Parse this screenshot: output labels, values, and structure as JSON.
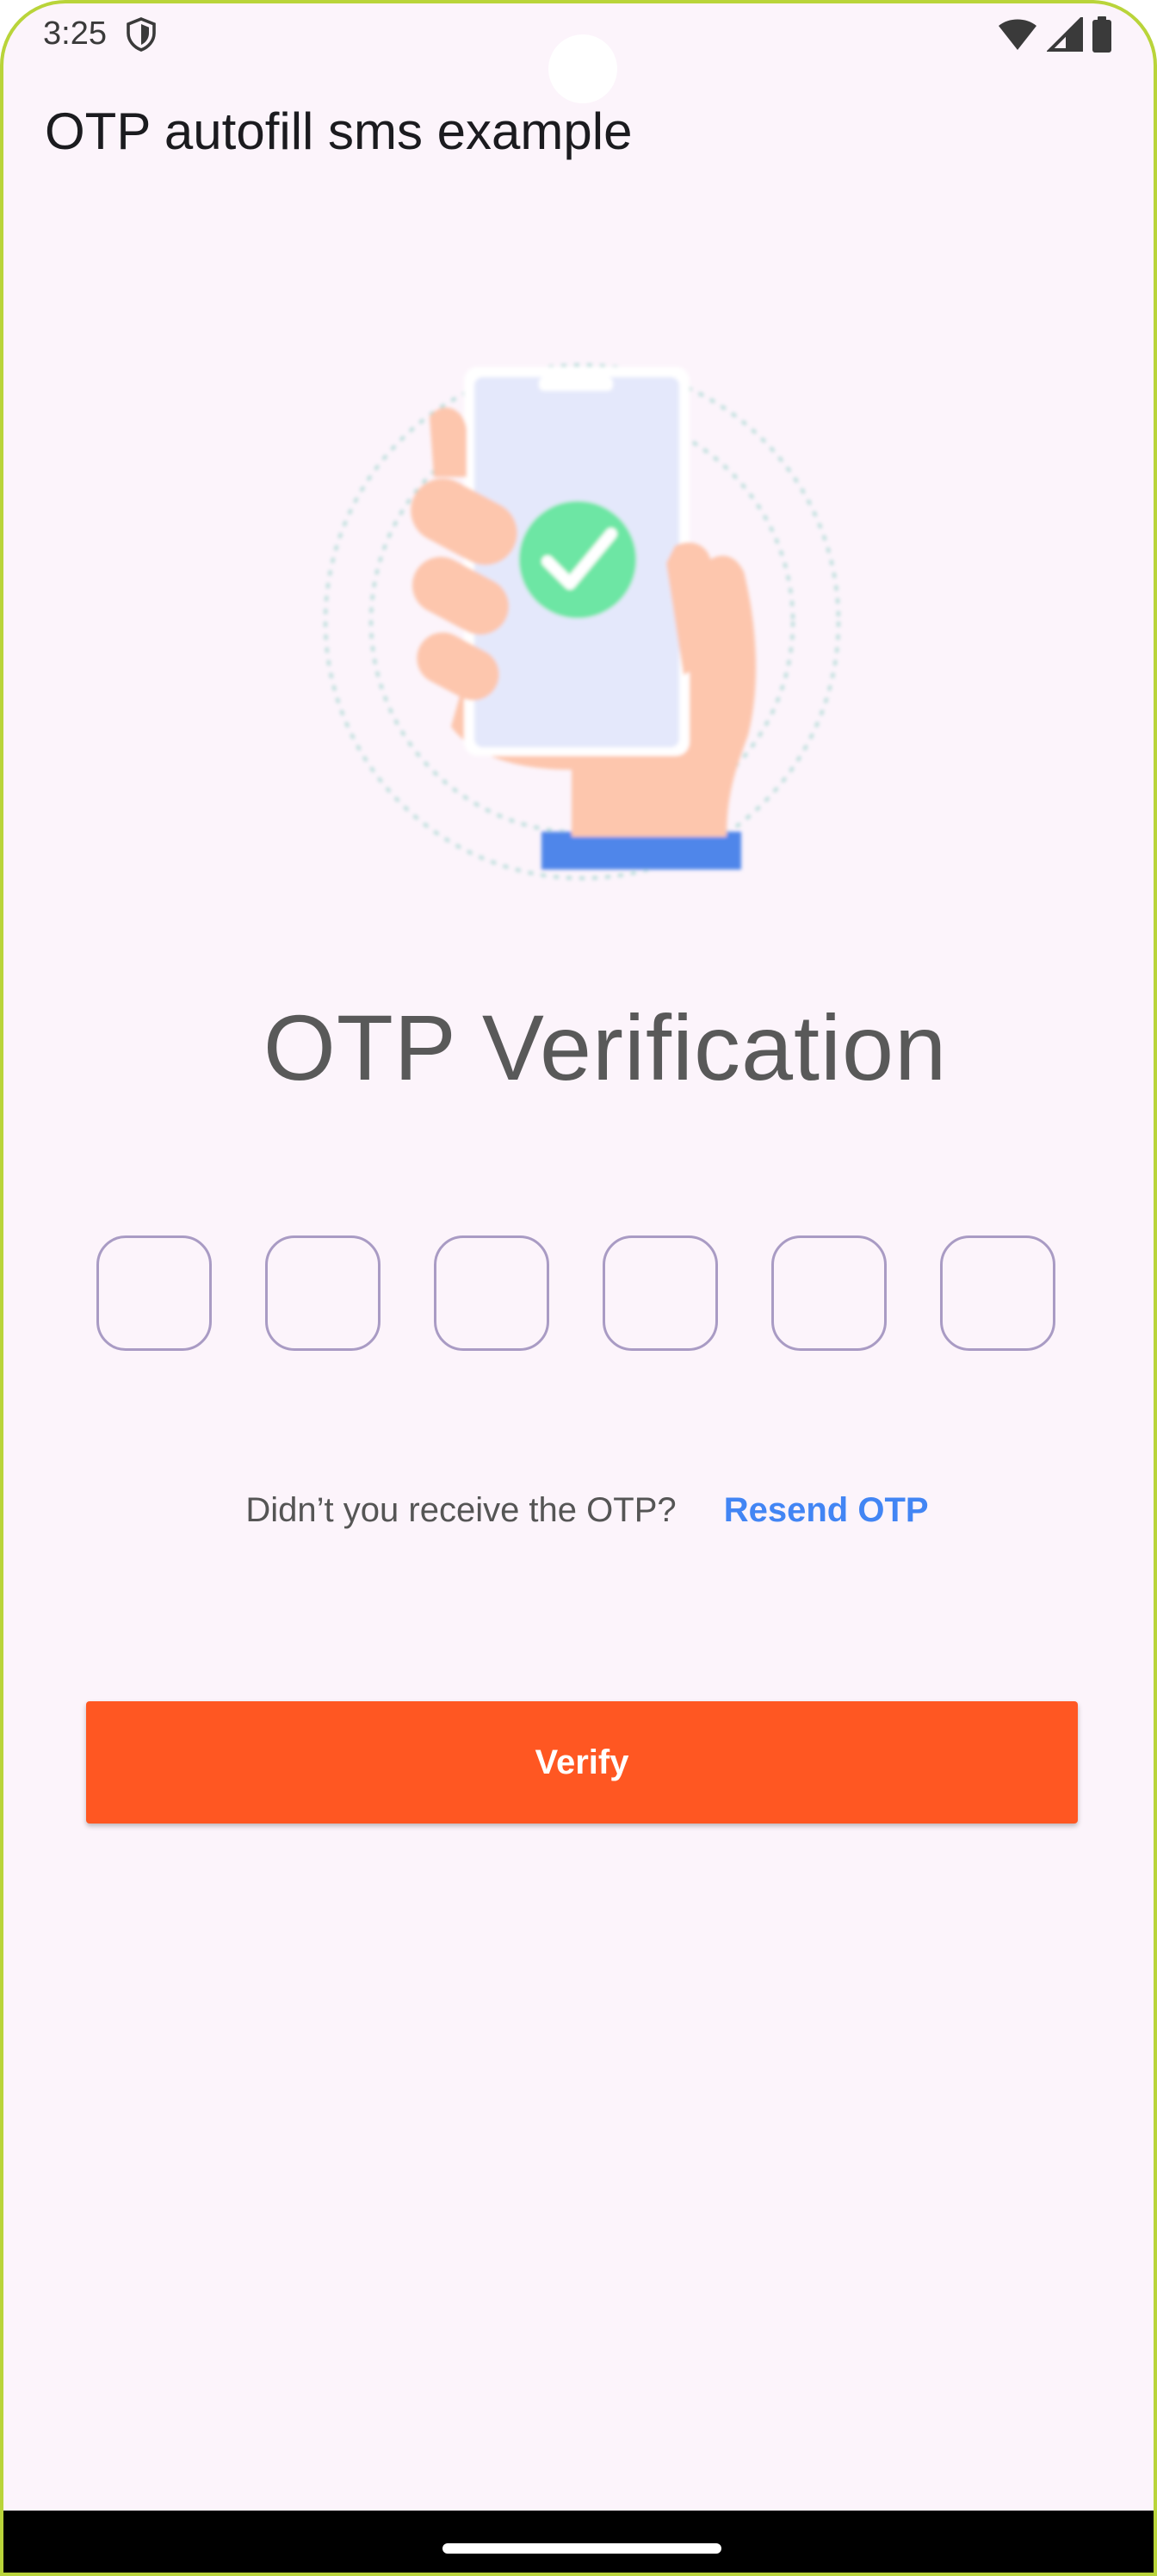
{
  "status_bar": {
    "time": "3:25",
    "icons": [
      "shield-icon",
      "wifi-icon",
      "signal-icon",
      "battery-icon"
    ]
  },
  "app_bar": {
    "title": "OTP autofill sms example"
  },
  "illustration": {
    "icon": "phone-verified-illustration"
  },
  "main": {
    "heading": "OTP Verification",
    "otp_fields": [
      {
        "value": "",
        "placeholder": ""
      },
      {
        "value": "",
        "placeholder": ""
      },
      {
        "value": "",
        "placeholder": ""
      },
      {
        "value": "",
        "placeholder": ""
      },
      {
        "value": "",
        "placeholder": ""
      },
      {
        "value": "",
        "placeholder": ""
      }
    ],
    "resend_question": "Didn’t you receive the OTP?",
    "resend_link": "Resend OTP",
    "verify_label": "Verify"
  },
  "colors": {
    "background": "#fcf4fb",
    "accent_button": "#ff5722",
    "link": "#4285f4",
    "otp_border": "#a99bc4"
  }
}
